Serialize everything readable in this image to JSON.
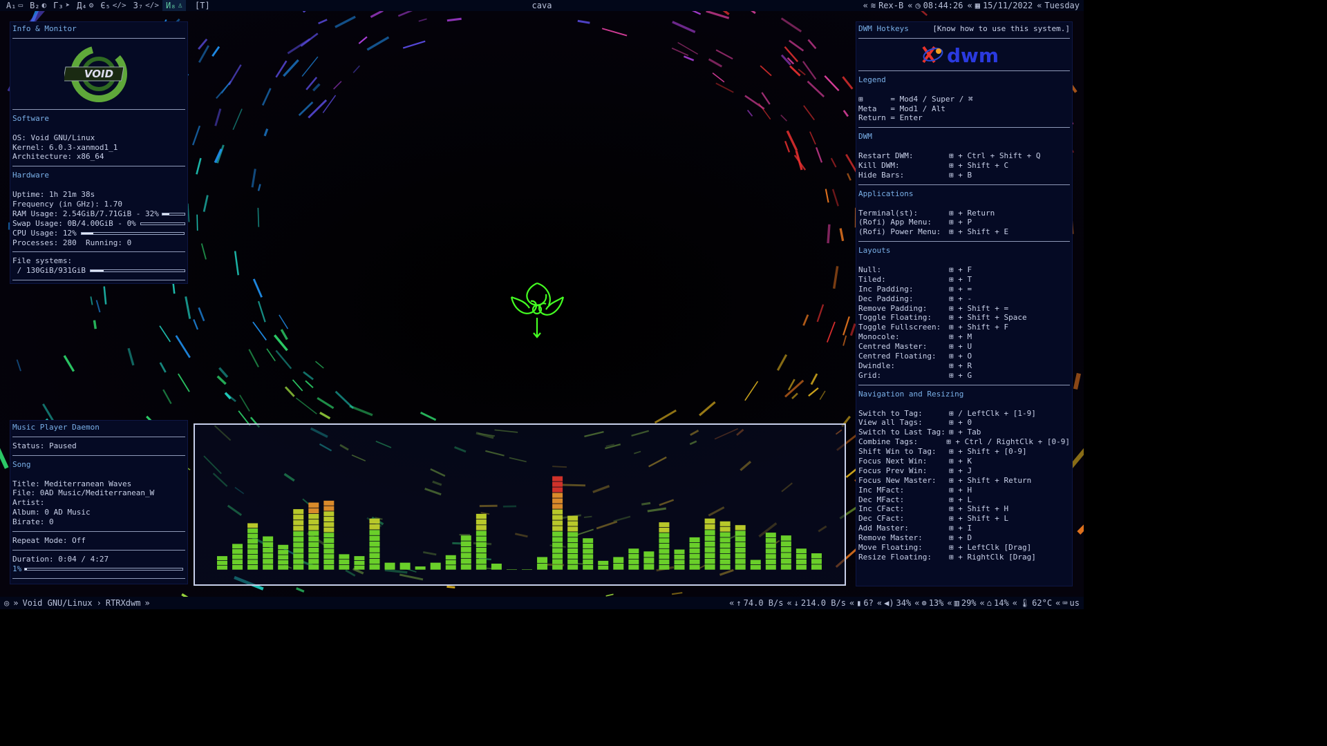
{
  "topbar": {
    "tags": [
      {
        "label": "A₁",
        "icon": "terminal-icon",
        "glyph": "▭"
      },
      {
        "label": "B₂",
        "icon": "firefox-icon",
        "glyph": "◐"
      },
      {
        "label": "Г₃",
        "icon": "telegram-icon",
        "glyph": "➤"
      },
      {
        "label": "Д₄",
        "icon": "steam-icon",
        "glyph": "⚙"
      },
      {
        "label": "Є₅",
        "icon": "code-icon",
        "glyph": "</>"
      },
      {
        "label": "З₇",
        "icon": "code-icon",
        "glyph": "</>"
      },
      {
        "label": "И₈",
        "icon": "linux-icon",
        "glyph": "♙"
      }
    ],
    "layout": "[T]",
    "window_title": "cava",
    "status": [
      {
        "icon": "wifi-icon",
        "glyph": "≋",
        "text": "Rex-B"
      },
      {
        "icon": "clock-icon",
        "glyph": "◷",
        "text": "08:44:26"
      },
      {
        "icon": "calendar-icon",
        "glyph": "▦",
        "text": "15/11/2022"
      },
      {
        "icon": "day-icon",
        "glyph": "",
        "text": "Tuesday"
      }
    ]
  },
  "left_panel": {
    "title": "Info & Monitor",
    "logo_text": "VOID",
    "software": {
      "heading": "Software",
      "os": "OS: Void GNU/Linux",
      "kernel": "Kernel: 6.0.3-xanmod1_1",
      "arch": "Architecture: x86_64"
    },
    "hardware": {
      "heading": "Hardware",
      "uptime": "Uptime: 1h 21m 38s",
      "freq": "Frequency (in GHz): 1.70",
      "ram": "RAM Usage: 2.54GiB/7.71GiB - 32%",
      "ram_pct": 0.32,
      "swap": "Swap Usage: 0B/4.00GiB - 0%",
      "swap_pct": 0.0,
      "cpu": "CPU Usage: 12%",
      "cpu_pct": 0.12,
      "procs": "Processes: 280  Running: 0"
    },
    "fs": {
      "heading": "File systems:",
      "root": " / 130GiB/931GiB",
      "root_pct": 0.14
    }
  },
  "mpd_panel": {
    "title": "Music Player Daemon",
    "status": "Status: Paused",
    "song_heading": "Song",
    "title_line": "Title: Mediterranean Waves",
    "file_line": "File: 0AD Music/Mediterranean_W",
    "artist_line": "Artist:",
    "album_line": "Album: 0 AD Music",
    "bitrate_line": "Birate: 0",
    "repeat": "Repeat Mode: Off",
    "duration": "Duration: 0:04 / 4:27",
    "progress_label": "1%",
    "progress": 0.01
  },
  "hotkeys": {
    "title": "DWM Hotkeys",
    "hint": "[Know how to use this system.]",
    "logo_text": "dwm",
    "legend": {
      "heading": "Legend",
      "lines": [
        "⊞      = Mod4 / Super / ⌘",
        "Meta   = Mod1 / Alt",
        "Return = Enter"
      ]
    },
    "sections": [
      {
        "heading": "DWM",
        "rows": [
          [
            "Restart DWM:",
            "⊞ + Ctrl + Shift + Q"
          ],
          [
            "Kill DWM:",
            "⊞ + Shift + C"
          ],
          [
            "Hide Bars:",
            "⊞ + B"
          ]
        ]
      },
      {
        "heading": "Applications",
        "rows": [
          [
            "Terminal(st):",
            "⊞ + Return"
          ],
          [
            "(Rofi) App Menu:",
            "⊞ + P"
          ],
          [
            "(Rofi) Power Menu:",
            "⊞ + Shift + E"
          ]
        ]
      },
      {
        "heading": "Layouts",
        "rows": [
          [
            "Null:",
            "⊞ + F"
          ],
          [
            "Tiled:",
            "⊞ + T"
          ],
          [
            "Inc Padding:",
            "⊞ + ="
          ],
          [
            "Dec Padding:",
            "⊞ + -"
          ],
          [
            "Remove Padding:",
            "⊞ + Shift + ="
          ],
          [
            "Toggle Floating:",
            "⊞ + Shift + Space"
          ],
          [
            "Toggle Fullscreen:",
            "⊞ + Shift + F"
          ],
          [
            "Monocole:",
            "⊞ + M"
          ],
          [
            "Centred Master:",
            "⊞ + U"
          ],
          [
            "Centred Floating:",
            "⊞ + O"
          ],
          [
            "Dwindle:",
            "⊞ + R"
          ],
          [
            "Grid:",
            "⊞ + G"
          ]
        ]
      },
      {
        "heading": "Navigation and Resizing",
        "rows": [
          [
            "Switch to Tag:",
            "⊞ / LeftClk + [1-9]"
          ],
          [
            "View all Tags:",
            "⊞ + 0"
          ],
          [
            "Switch to Last Tag:",
            "⊞ + Tab"
          ],
          [
            "Combine Tags:",
            "⊞ + Ctrl / RightClk + [0-9]"
          ],
          [
            "Shift Win to Tag:",
            "⊞ + Shift + [0-9]"
          ],
          [
            "Focus Next Win:",
            "⊞ + K"
          ],
          [
            "Focus Prev Win:",
            "⊞ + J"
          ],
          [
            "Focus New Master:",
            "⊞ + Shift + Return"
          ],
          [
            "Inc MFact:",
            "⊞ + H"
          ],
          [
            "Dec MFact:",
            "⊞ + L"
          ],
          [
            "Inc CFact:",
            "⊞ + Shift + H"
          ],
          [
            "Dec CFact:",
            "⊞ + Shift + L"
          ],
          [
            "Add Master:",
            "⊞ + I"
          ],
          [
            "Remove Master:",
            "⊞ + D"
          ],
          [
            "Move Floating:",
            "⊞ + LeftClk [Drag]"
          ],
          [
            "Resize Floating:",
            "⊞ + RightClk [Drag]"
          ]
        ]
      }
    ]
  },
  "cava": {
    "bar_levels": [
      0.15,
      0.28,
      0.5,
      0.36,
      0.27,
      0.65,
      0.72,
      0.74,
      0.17,
      0.15,
      0.55,
      0.08,
      0.08,
      0.04,
      0.08,
      0.16,
      0.37,
      0.6,
      0.07,
      0.01,
      0.01,
      0.14,
      1.0,
      0.58,
      0.34,
      0.1,
      0.14,
      0.23,
      0.2,
      0.51,
      0.22,
      0.35,
      0.55,
      0.52,
      0.48,
      0.11,
      0.4,
      0.37,
      0.23,
      0.18
    ]
  },
  "bottombar": {
    "left": [
      {
        "icon": "void-icon",
        "glyph": "◎",
        "text": "»"
      },
      {
        "icon": "",
        "glyph": "",
        "text": "Void GNU/Linux"
      },
      {
        "icon": "",
        "glyph": "",
        "text": "›"
      },
      {
        "icon": "",
        "glyph": "",
        "text": "RTRXdwm"
      },
      {
        "icon": "",
        "glyph": "",
        "text": "»"
      }
    ],
    "right": [
      {
        "icon": "upload-icon",
        "glyph": "↑",
        "text": "74.0 B/s"
      },
      {
        "icon": "download-icon",
        "glyph": "↓",
        "text": "214.0 B/s"
      },
      {
        "icon": "battery-icon",
        "glyph": "▮",
        "text": "6?"
      },
      {
        "icon": "volume-icon",
        "glyph": "◀)",
        "text": "34%"
      },
      {
        "icon": "cpu-icon",
        "glyph": "⊚",
        "text": "13%"
      },
      {
        "icon": "memory-icon",
        "glyph": "▥",
        "text": "29%"
      },
      {
        "icon": "disk-icon",
        "glyph": "⌂",
        "text": "14%"
      },
      {
        "icon": "temp-icon",
        "glyph": "🌡",
        "text": "62°C"
      },
      {
        "icon": "keyboard-icon",
        "glyph": "⌨",
        "text": "us"
      }
    ]
  },
  "colors": {
    "panel_bg": "#050a24",
    "accent": "#7ab0e8",
    "text": "#c8d0e8",
    "bar_green": "#6acf2a",
    "bar_red": "#d0322a"
  }
}
